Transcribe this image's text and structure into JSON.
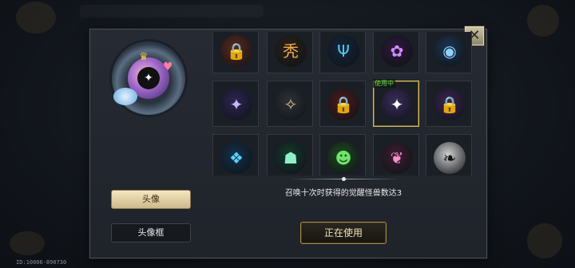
{
  "panel": {
    "close_glyph": "✕",
    "tabs": [
      {
        "label": "头像",
        "active": true
      },
      {
        "label": "头像框",
        "active": false
      }
    ],
    "preview_icon": "awakened-beast-avatar",
    "in_use_tag": "使用中",
    "description": "召唤十次时获得的觉醒怪兽数达3",
    "action_button": "正在使用"
  },
  "avatars": [
    {
      "icon": "lock-icon",
      "glyph": "🔒",
      "ring": "#5a2a1e",
      "color": "#d8d0c4"
    },
    {
      "icon": "crown-glyph-icon",
      "glyph": "秃",
      "ring": "#2b2218",
      "color": "#f2a94a"
    },
    {
      "icon": "trident-icon",
      "glyph": "Ψ",
      "ring": "#16263a",
      "color": "#4fc7f0"
    },
    {
      "icon": "rose-icon",
      "glyph": "✿",
      "ring": "#2a1a3a",
      "color": "#d58bff"
    },
    {
      "icon": "location-icon",
      "glyph": "◉",
      "ring": "#1d3550",
      "color": "#8fd0ff"
    },
    {
      "icon": "star-orb-icon",
      "glyph": "✦",
      "ring": "#2b2550",
      "color": "#c9b6ff"
    },
    {
      "icon": "compass-star-icon",
      "glyph": "✧",
      "ring": "#2e3035",
      "color": "#d6c79a"
    },
    {
      "icon": "lock-icon",
      "glyph": "🔒",
      "ring": "#4a1c1c",
      "color": "#d8d0c4"
    },
    {
      "icon": "awakened-beast-icon",
      "glyph": "✦",
      "ring": "#3a2c5a",
      "color": "#ffffff",
      "selected": true
    },
    {
      "icon": "lock-icon",
      "glyph": "🔒",
      "ring": "#3a2450",
      "color": "#d8d0c4"
    },
    {
      "icon": "blue-wing-icon",
      "glyph": "❖",
      "ring": "#14304a",
      "color": "#5ad0ff"
    },
    {
      "icon": "green-ghost-icon",
      "glyph": "☗",
      "ring": "#153a2c",
      "color": "#8ff0c8"
    },
    {
      "icon": "green-beast-icon",
      "glyph": "☻",
      "ring": "#1f4a20",
      "color": "#6ee36a"
    },
    {
      "icon": "pink-cloud-icon",
      "glyph": "❦",
      "ring": "#3a1e30",
      "color": "#ff8fd0"
    },
    {
      "icon": "black-seaweed-icon",
      "glyph": "❧",
      "ring": "#cfcfcf",
      "color": "#111111"
    }
  ],
  "footer": {
    "id_text": "ID:10006-890730"
  },
  "colors": {
    "accent_gold": "#d9bf6a",
    "in_use_green": "#6be04a",
    "panel": "#22262d"
  }
}
